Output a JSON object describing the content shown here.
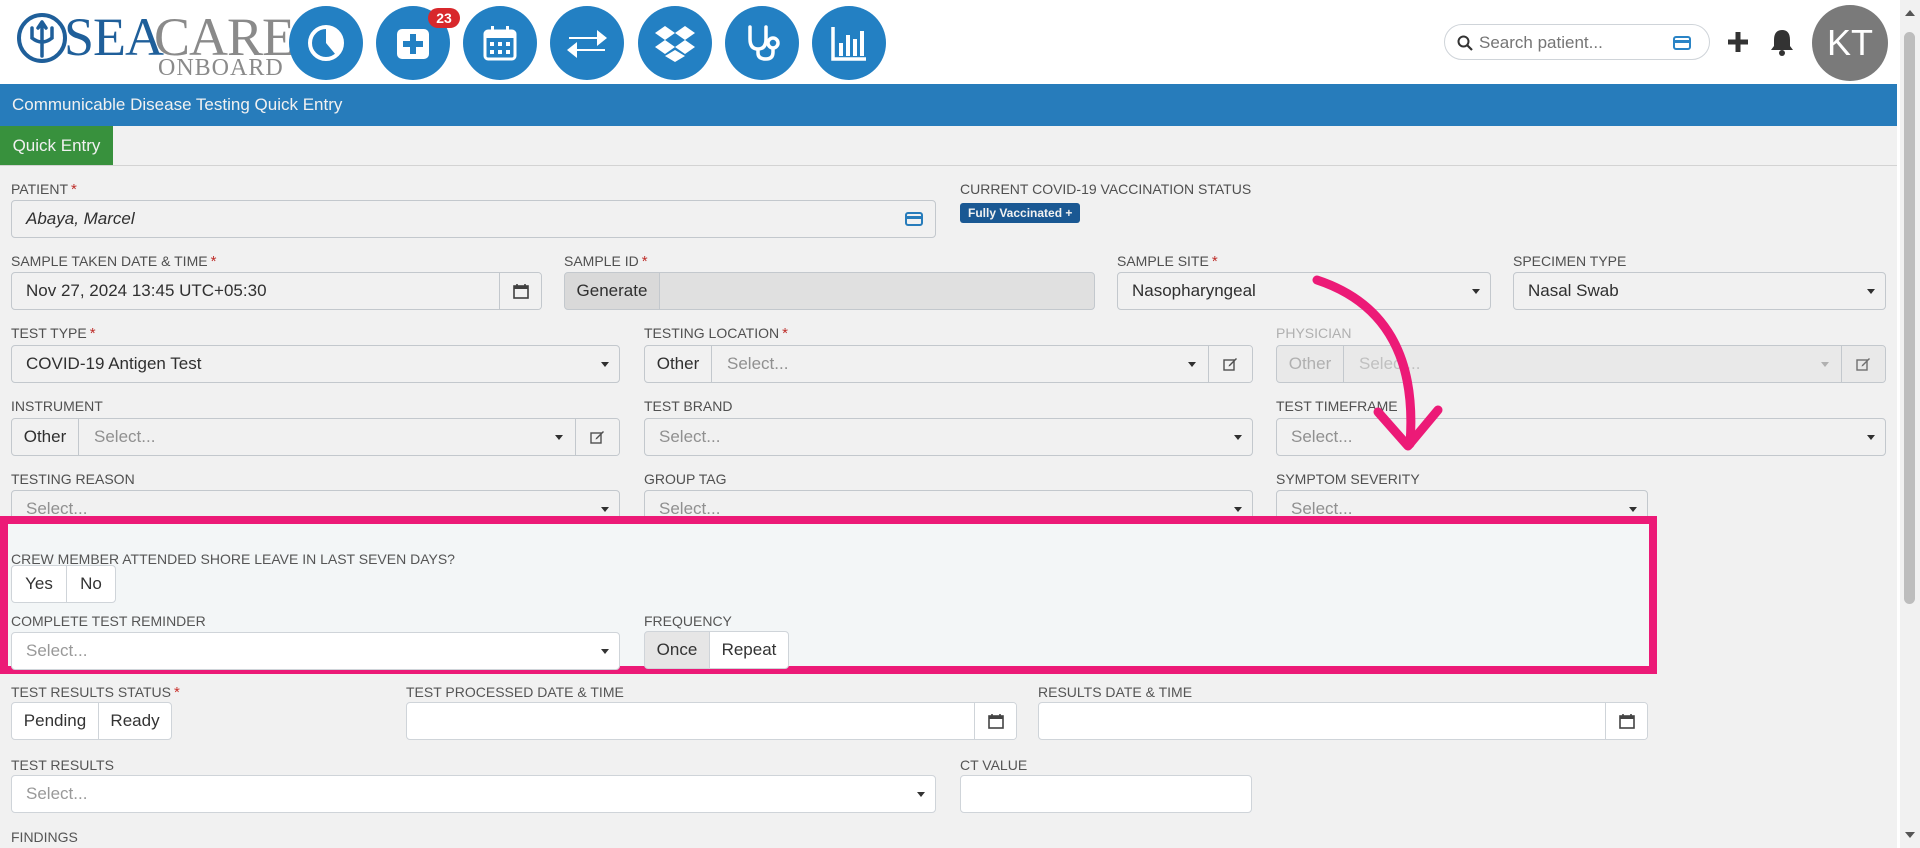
{
  "brand": {
    "name_sea": "SEA",
    "name_care": "CARE",
    "name_sub": "ONBOARD"
  },
  "nav": {
    "badge_count": "23",
    "icons": [
      "pie-chart-icon",
      "medical-plus-icon",
      "calendar-icon",
      "transfer-icon",
      "dropbox-icon",
      "stethoscope-icon",
      "bar-chart-icon"
    ]
  },
  "header": {
    "search_placeholder": "Search patient...",
    "avatar_initials": "KT"
  },
  "page": {
    "title": "Communicable Disease Testing Quick Entry",
    "tab": "Quick Entry"
  },
  "form": {
    "patient": {
      "label": "PATIENT",
      "required": "*",
      "value": "Abaya, Marcel"
    },
    "vaccination": {
      "label": "CURRENT COVID-19 VACCINATION STATUS",
      "badge": "Fully Vaccinated +"
    },
    "sample_datetime": {
      "label": "SAMPLE TAKEN DATE & TIME",
      "required": "*",
      "value": "Nov 27, 2024 13:45 UTC+05:30"
    },
    "sample_id": {
      "label": "SAMPLE ID",
      "required": "*",
      "button": "Generate"
    },
    "sample_site": {
      "label": "SAMPLE SITE",
      "required": "*",
      "value": "Nasopharyngeal"
    },
    "specimen_type": {
      "label": "SPECIMEN TYPE",
      "value": "Nasal Swab"
    },
    "test_type": {
      "label": "TEST TYPE",
      "required": "*",
      "value": "COVID-19 Antigen Test"
    },
    "testing_location": {
      "label": "TESTING LOCATION",
      "required": "*",
      "prefix": "Other",
      "placeholder": "Select..."
    },
    "physician": {
      "label": "PHYSICIAN",
      "prefix": "Other",
      "placeholder": "Select..."
    },
    "instrument": {
      "label": "INSTRUMENT",
      "prefix": "Other",
      "placeholder": "Select..."
    },
    "test_brand": {
      "label": "TEST BRAND",
      "placeholder": "Select..."
    },
    "test_timeframe": {
      "label": "TEST TIMEFRAME",
      "placeholder": "Select..."
    },
    "testing_reason": {
      "label": "TESTING REASON",
      "placeholder": "Select..."
    },
    "group_tag": {
      "label": "GROUP TAG",
      "placeholder": "Select..."
    },
    "symptom_severity": {
      "label": "SYMPTOM SEVERITY",
      "placeholder": "Select..."
    },
    "shore_leave": {
      "label": "CREW MEMBER ATTENDED SHORE LEAVE IN LAST SEVEN DAYS?",
      "yes": "Yes",
      "no": "No"
    },
    "reminder": {
      "label": "COMPLETE TEST REMINDER",
      "placeholder": "Select..."
    },
    "frequency": {
      "label": "FREQUENCY",
      "once": "Once",
      "repeat": "Repeat"
    },
    "results_status": {
      "label": "TEST RESULTS STATUS",
      "required": "*",
      "pending": "Pending",
      "ready": "Ready"
    },
    "processed_datetime": {
      "label": "TEST PROCESSED DATE & TIME"
    },
    "results_datetime": {
      "label": "RESULTS DATE & TIME"
    },
    "test_results": {
      "label": "TEST RESULTS",
      "placeholder": "Select..."
    },
    "ct_value": {
      "label": "CT VALUE"
    },
    "findings": {
      "label": "FINDINGS"
    }
  },
  "colors": {
    "brand_blue": "#2380c3",
    "title_bar": "#2a84c6",
    "tab_green": "#3c9a41",
    "highlight": "#ec1a77",
    "required": "#c9302c"
  }
}
